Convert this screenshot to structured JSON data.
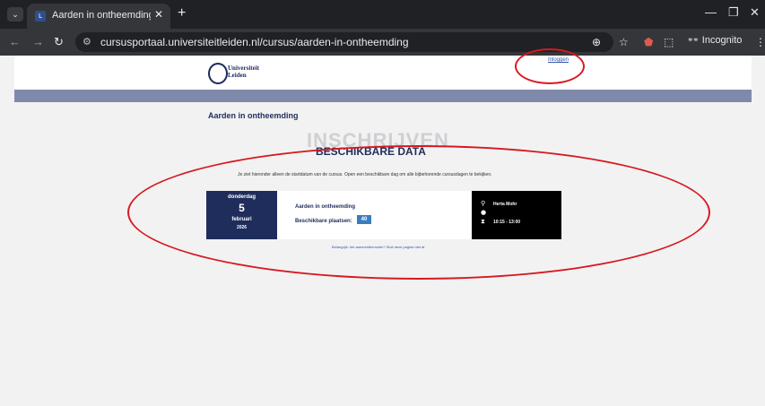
{
  "browser": {
    "tab_title": "Aarden in ontheemding · Curs…",
    "url_host": "cursusportaal.universiteitleiden.nl",
    "url_path": "/cursus/aarden-in-ontheemding",
    "incognito_label": "Incognito",
    "icons": [
      "tab-list-icon",
      "favicon",
      "close-icon",
      "new-tab-icon",
      "minimize-icon",
      "restore-icon",
      "close-window-icon",
      "back-icon",
      "forward-icon",
      "reload-icon",
      "site-info-icon",
      "zoom-icon",
      "bookmark-star-icon",
      "extension-shield-icon",
      "extensions-icon",
      "incognito-icon",
      "menu-icon"
    ]
  },
  "header": {
    "logo_line1": "Universiteit",
    "logo_line2": "Leiden",
    "login_label": "Inloggen"
  },
  "course": {
    "title": "Aarden in ontheemding",
    "bg_heading": "INSCHRIJVEN",
    "heading": "BESCHIKBARE DATA",
    "intro": "Je ziet hieronder alleen de startdatum van de cursus. Open een beschikbare dag om alle bijbehorende cursusdagen te bekijken."
  },
  "session": {
    "weekday": "donderdag",
    "day": "5",
    "month": "februari",
    "year": "2026",
    "course_name": "Aarden in ontheemding",
    "places_label": "Beschikbare plaatsen:",
    "places_value": "40",
    "location": "Herta Mohr",
    "time": "10:15 - 13:00"
  },
  "footer": {
    "link_text": "Belangrijk: het aanmeldformulier? Sluit deze pagina niet af"
  },
  "colors": {
    "brand_navy": "#1f2d5c",
    "band": "#7f8aaa",
    "badge": "#3a7dbf",
    "annotation_red": "#d71920"
  }
}
